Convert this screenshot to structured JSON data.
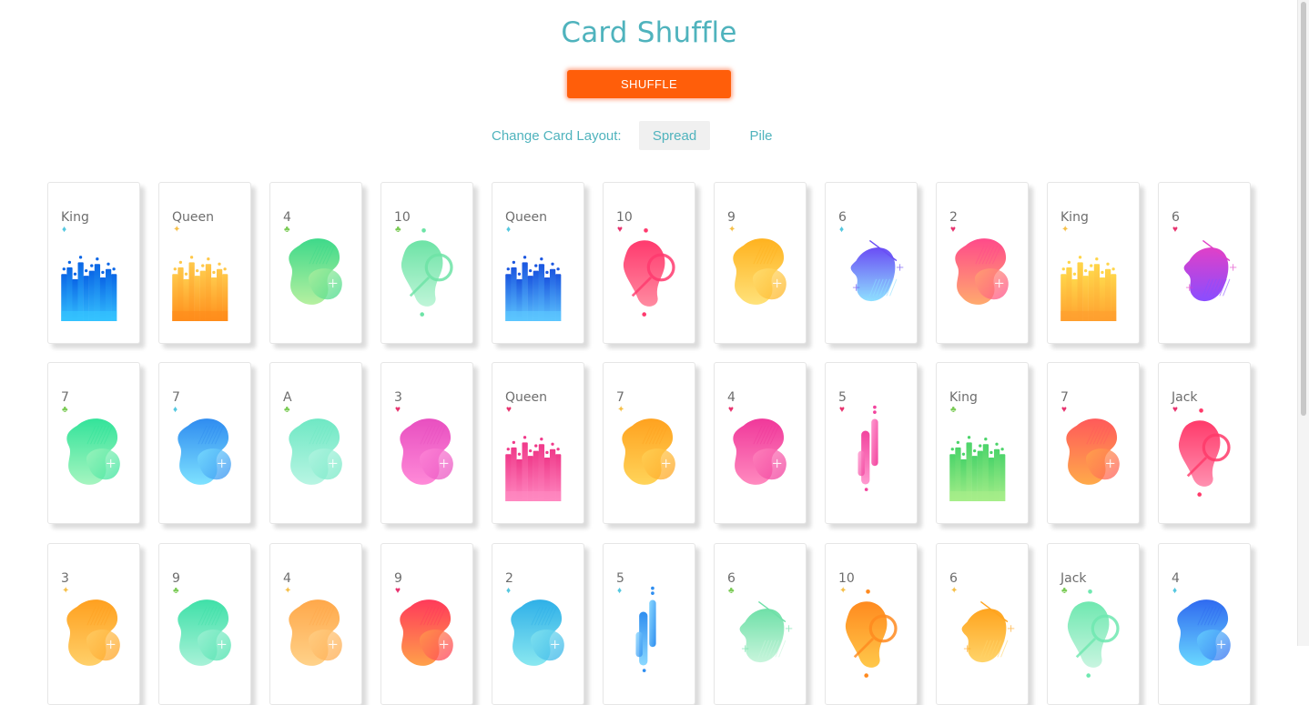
{
  "title": "Card Shuffle",
  "shuffle_label": "SHUFFLE",
  "layout": {
    "label": "Change Card Layout:",
    "options": [
      "Spread",
      "Pile"
    ],
    "selected": "Spread"
  },
  "colors": {
    "accent": "#4fb3bd",
    "button": "#ff5e0a",
    "hearts": "#e8336f",
    "diamonds": "#56c8e0",
    "clubs": "#7acb55",
    "spades": "#f6c04a"
  },
  "suit_glyphs": {
    "hearts": "♥",
    "diamonds": "♦",
    "clubs": "♣",
    "spades": "✦"
  },
  "cards": [
    [
      {
        "rank": "King",
        "suit": "diamonds",
        "art": "drip",
        "c1": "#0a66e6",
        "c2": "#36c4ff"
      },
      {
        "rank": "Queen",
        "suit": "spades",
        "art": "drip",
        "c1": "#ffc84a",
        "c2": "#ff8c1a"
      },
      {
        "rank": "4",
        "suit": "clubs",
        "art": "blob",
        "c1": "#3ed98a",
        "c2": "#b6f0a0"
      },
      {
        "rank": "10",
        "suit": "clubs",
        "art": "ring",
        "c1": "#6de3a6",
        "c2": "#bff5d8"
      },
      {
        "rank": "Queen",
        "suit": "diamonds",
        "art": "drip",
        "c1": "#1b56e0",
        "c2": "#5ec8ff"
      },
      {
        "rank": "10",
        "suit": "hearts",
        "art": "ring",
        "c1": "#ff3a6e",
        "c2": "#ff8aa0"
      },
      {
        "rank": "9",
        "suit": "spades",
        "art": "blob",
        "c1": "#ffb21f",
        "c2": "#ffe27a"
      },
      {
        "rank": "6",
        "suit": "diamonds",
        "art": "horn",
        "c1": "#6a4df5",
        "c2": "#8ee0ff"
      },
      {
        "rank": "2",
        "suit": "hearts",
        "art": "blob",
        "c1": "#ff4a8a",
        "c2": "#ffaa6e"
      },
      {
        "rank": "King",
        "suit": "spades",
        "art": "drip",
        "c1": "#ffd54a",
        "c2": "#ff9f2e"
      },
      {
        "rank": "6",
        "suit": "hearts",
        "art": "horn",
        "c1": "#e040c8",
        "c2": "#8a4dff"
      }
    ],
    [
      {
        "rank": "7",
        "suit": "clubs",
        "art": "blob",
        "c1": "#33e39a",
        "c2": "#a6f5c0"
      },
      {
        "rank": "7",
        "suit": "diamonds",
        "art": "blob",
        "c1": "#2f8cf0",
        "c2": "#7ee2ff"
      },
      {
        "rank": "A",
        "suit": "clubs",
        "art": "blob",
        "c1": "#6fe8c4",
        "c2": "#b8f5e3"
      },
      {
        "rank": "3",
        "suit": "hearts",
        "art": "blob",
        "c1": "#e84fc0",
        "c2": "#ff8ad8"
      },
      {
        "rank": "Queen",
        "suit": "hearts",
        "art": "drip",
        "c1": "#f03a8a",
        "c2": "#ff8ac2"
      },
      {
        "rank": "7",
        "suit": "spades",
        "art": "blob",
        "c1": "#ffa21f",
        "c2": "#ffd45a"
      },
      {
        "rank": "4",
        "suit": "hearts",
        "art": "blob",
        "c1": "#f0389a",
        "c2": "#ff8abf"
      },
      {
        "rank": "5",
        "suit": "hearts",
        "art": "bars",
        "c1": "#f2449e",
        "c2": "#ff9ad0"
      },
      {
        "rank": "King",
        "suit": "clubs",
        "art": "drip",
        "c1": "#4cd46a",
        "c2": "#a8ee8a"
      },
      {
        "rank": "7",
        "suit": "hearts",
        "art": "blob",
        "c1": "#ff5a5a",
        "c2": "#ffaa4a"
      },
      {
        "rank": "Jack",
        "suit": "hearts",
        "art": "ring",
        "c1": "#ff3a6a",
        "c2": "#ff90b0"
      }
    ],
    [
      {
        "rank": "3",
        "suit": "spades",
        "art": "blob",
        "c1": "#ffa01f",
        "c2": "#ffd06a"
      },
      {
        "rank": "9",
        "suit": "clubs",
        "art": "blob",
        "c1": "#3fe0a8",
        "c2": "#a8f2d8"
      },
      {
        "rank": "4",
        "suit": "spades",
        "art": "blob",
        "c1": "#ffa84a",
        "c2": "#ffd28a"
      },
      {
        "rank": "9",
        "suit": "hearts",
        "art": "blob",
        "c1": "#ff3a5a",
        "c2": "#ffa04a"
      },
      {
        "rank": "2",
        "suit": "diamonds",
        "art": "blob",
        "c1": "#2fb0e8",
        "c2": "#8ae8f0"
      },
      {
        "rank": "5",
        "suit": "diamonds",
        "art": "bars",
        "c1": "#2f8ef0",
        "c2": "#8ad8ff"
      },
      {
        "rank": "6",
        "suit": "clubs",
        "art": "horn",
        "c1": "#6fe0a8",
        "c2": "#c8f5dc"
      },
      {
        "rank": "10",
        "suit": "spades",
        "art": "ring",
        "c1": "#ff8a1f",
        "c2": "#ffc84a"
      },
      {
        "rank": "6",
        "suit": "spades",
        "art": "horn",
        "c1": "#ffa41f",
        "c2": "#ffd46a"
      },
      {
        "rank": "Jack",
        "suit": "clubs",
        "art": "ring",
        "c1": "#6fe8b0",
        "c2": "#c8f5e0"
      },
      {
        "rank": "4",
        "suit": "diamonds",
        "art": "blob",
        "c1": "#2f6af0",
        "c2": "#6ad8ff"
      }
    ]
  ]
}
